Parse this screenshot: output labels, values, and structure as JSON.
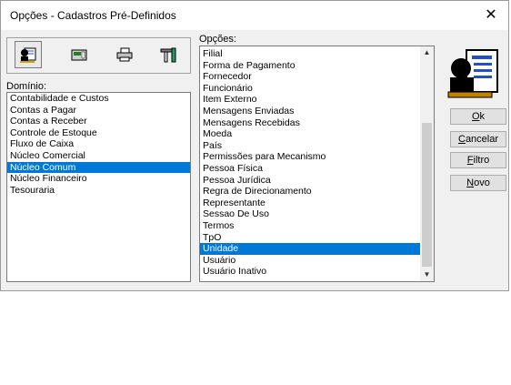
{
  "window": {
    "title": "Opções - Cadastros Pré-Definidos",
    "close_glyph": "✕"
  },
  "toolbar": {
    "buttons": [
      "person-card-icon",
      "register-icon",
      "printer-icon",
      "tools-icon"
    ]
  },
  "dominio": {
    "label": "Domínio:",
    "items": [
      "Contabilidade e Custos",
      "Contas a Pagar",
      "Contas a Receber",
      "Controle de Estoque",
      "Fluxo de Caixa",
      "Núcleo Comercial",
      "Núcleo Comum",
      "Núcleo Financeiro",
      "Tesouraria"
    ],
    "selected": "Núcleo Comum"
  },
  "opcoes": {
    "label": "Opções:",
    "items": [
      "Filial",
      "Forma de Pagamento",
      "Fornecedor",
      "Funcionário",
      "Item Externo",
      "Mensagens Enviadas",
      "Mensagens Recebidas",
      "Moeda",
      "País",
      "Permissões para Mecanismo",
      "Pessoa Física",
      "Pessoa Jurídica",
      "Regra de Direcionamento",
      "Representante",
      "Sessao De Uso",
      "Termos",
      "TpO",
      "Unidade",
      "Usuário",
      "Usuário Inativo"
    ],
    "selected": "Unidade"
  },
  "buttons": {
    "ok": {
      "label": "Ok",
      "mnemonic": "O",
      "rest": "k"
    },
    "cancelar": {
      "label": "Cancelar",
      "mnemonic": "C",
      "rest": "ancelar"
    },
    "filtro": {
      "label": "Filtro",
      "mnemonic": "F",
      "rest": "iltro"
    },
    "novo": {
      "label": "Novo",
      "mnemonic": "N",
      "rest": "ovo"
    }
  }
}
